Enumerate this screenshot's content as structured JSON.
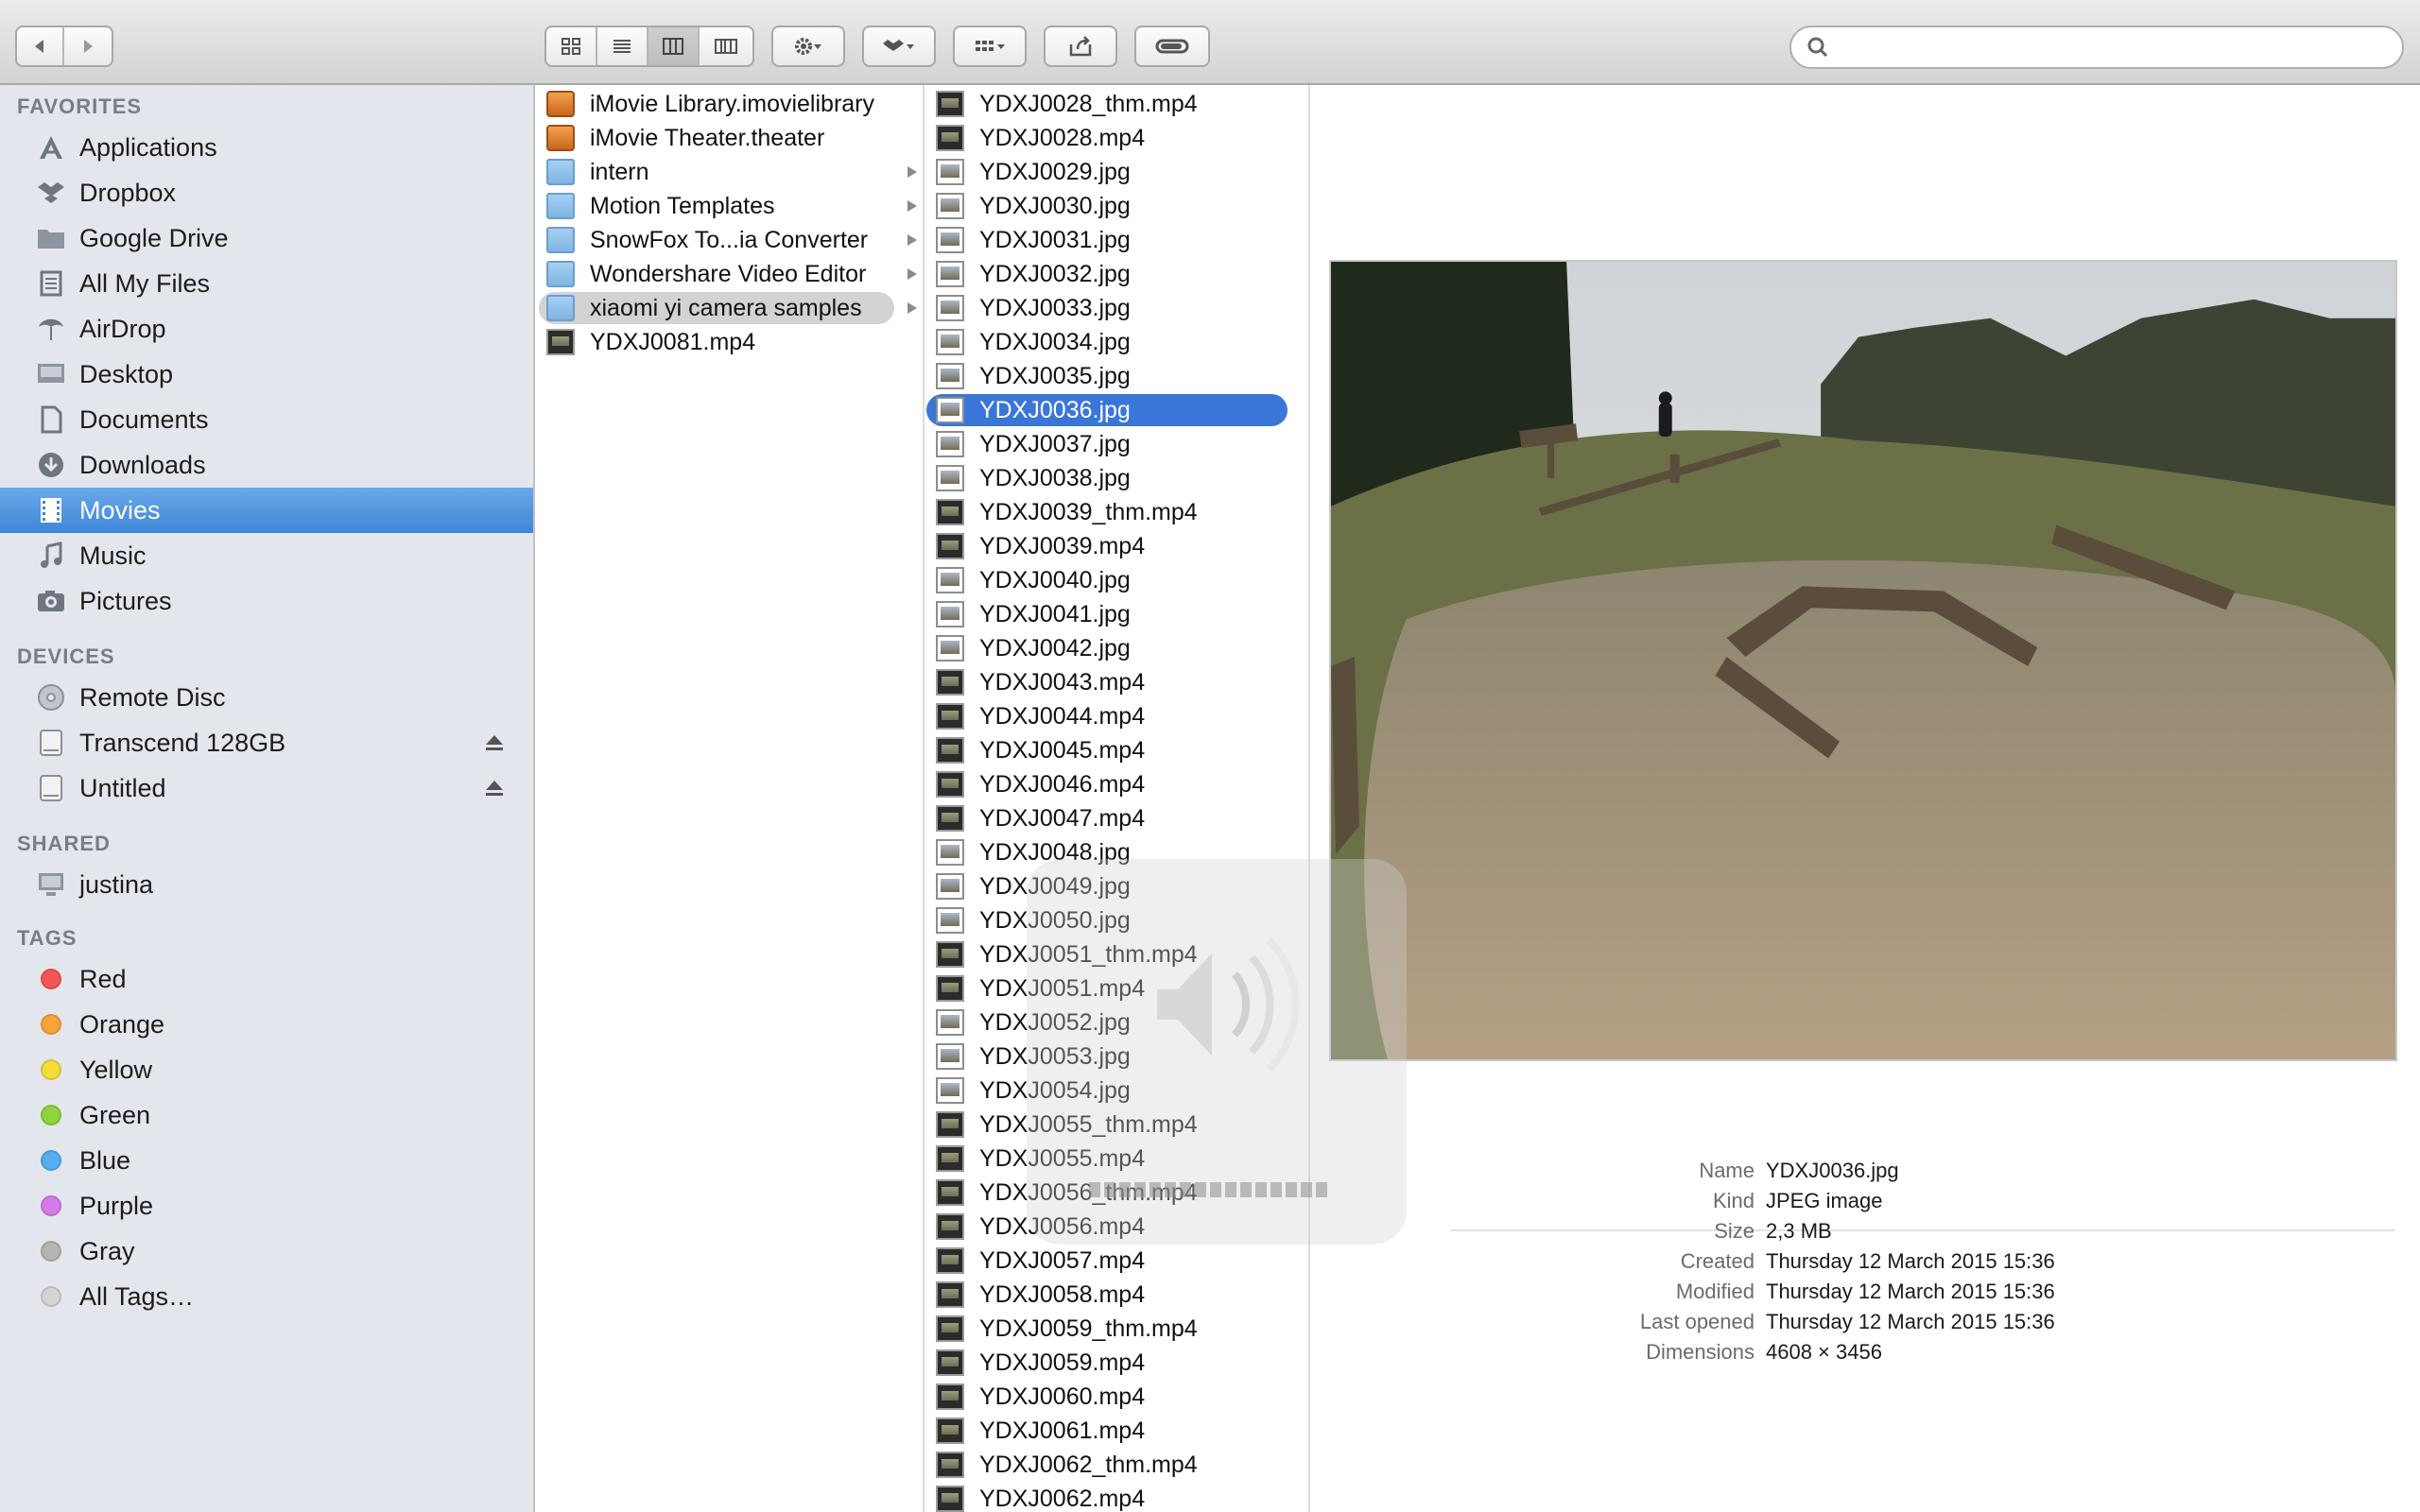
{
  "toolbar": {
    "nav": [
      "back",
      "forward"
    ],
    "view_modes": [
      "icon-view",
      "list-view",
      "column-view",
      "cover-flow-view"
    ],
    "active_view": "column-view",
    "search_placeholder": ""
  },
  "sidebar": {
    "favorites_header": "FAVORITES",
    "favorites": [
      {
        "label": "Applications",
        "icon": "applications-icon"
      },
      {
        "label": "Dropbox",
        "icon": "dropbox-icon"
      },
      {
        "label": "Google Drive",
        "icon": "folder-icon"
      },
      {
        "label": "All My Files",
        "icon": "all-files-icon"
      },
      {
        "label": "AirDrop",
        "icon": "airdrop-icon"
      },
      {
        "label": "Desktop",
        "icon": "desktop-icon"
      },
      {
        "label": "Documents",
        "icon": "documents-icon"
      },
      {
        "label": "Downloads",
        "icon": "downloads-icon"
      },
      {
        "label": "Movies",
        "icon": "movies-icon"
      },
      {
        "label": "Music",
        "icon": "music-icon"
      },
      {
        "label": "Pictures",
        "icon": "pictures-icon"
      }
    ],
    "selected_favorite": "Movies",
    "devices_header": "DEVICES",
    "devices": [
      {
        "label": "Remote Disc",
        "icon": "remote-disc-icon"
      },
      {
        "label": "Transcend 128GB",
        "icon": "disk-icon"
      },
      {
        "label": "Untitled",
        "icon": "disk-icon"
      }
    ],
    "shared_header": "SHARED",
    "shared": [
      {
        "label": "justina",
        "icon": "computer-icon"
      }
    ],
    "tags_header": "TAGS",
    "tags": [
      {
        "label": "Red",
        "color": "#f25757"
      },
      {
        "label": "Orange",
        "color": "#f7a53a"
      },
      {
        "label": "Yellow",
        "color": "#f3dd3b"
      },
      {
        "label": "Green",
        "color": "#8fd43a"
      },
      {
        "label": "Blue",
        "color": "#55aef0"
      },
      {
        "label": "Purple",
        "color": "#d57be8"
      },
      {
        "label": "Gray",
        "color": "#b5b5b5"
      },
      {
        "label": "All Tags…",
        "color": "#d4d4d4"
      }
    ]
  },
  "column1": [
    {
      "name": "iMovie Library.imovielibrary",
      "type": "imovie"
    },
    {
      "name": "iMovie Theater.theater",
      "type": "imovie"
    },
    {
      "name": "intern",
      "type": "folder"
    },
    {
      "name": "Motion Templates",
      "type": "folder"
    },
    {
      "name": "SnowFox To...ia Converter",
      "type": "folder"
    },
    {
      "name": "Wondershare Video Editor",
      "type": "folder"
    },
    {
      "name": "xiaomi yi camera samples",
      "type": "folder",
      "selected": true
    },
    {
      "name": "YDXJ0081.mp4",
      "type": "video"
    }
  ],
  "column2": [
    "YDXJ0028_thm.mp4",
    "YDXJ0028.mp4",
    "YDXJ0029.jpg",
    "YDXJ0030.jpg",
    "YDXJ0031.jpg",
    "YDXJ0032.jpg",
    "YDXJ0033.jpg",
    "YDXJ0034.jpg",
    "YDXJ0035.jpg",
    "YDXJ0036.jpg",
    "YDXJ0037.jpg",
    "YDXJ0038.jpg",
    "YDXJ0039_thm.mp4",
    "YDXJ0039.mp4",
    "YDXJ0040.jpg",
    "YDXJ0041.jpg",
    "YDXJ0042.jpg",
    "YDXJ0043.mp4",
    "YDXJ0044.mp4",
    "YDXJ0045.mp4",
    "YDXJ0046.mp4",
    "YDXJ0047.mp4",
    "YDXJ0048.jpg",
    "YDXJ0049.jpg",
    "YDXJ0050.jpg",
    "YDXJ0051_thm.mp4",
    "YDXJ0051.mp4",
    "YDXJ0052.jpg",
    "YDXJ0053.jpg",
    "YDXJ0054.jpg",
    "YDXJ0055_thm.mp4",
    "YDXJ0055.mp4",
    "YDXJ0056_thm.mp4",
    "YDXJ0056.mp4",
    "YDXJ0057.mp4",
    "YDXJ0058.mp4",
    "YDXJ0059_thm.mp4",
    "YDXJ0059.mp4",
    "YDXJ0060.mp4",
    "YDXJ0061.mp4",
    "YDXJ0062_thm.mp4",
    "YDXJ0062.mp4"
  ],
  "column2_selected": "YDXJ0036.jpg",
  "preview": {
    "info": [
      {
        "key": "Name",
        "value": "YDXJ0036.jpg"
      },
      {
        "key": "Kind",
        "value": "JPEG image"
      },
      {
        "key": "Size",
        "value": "2,3 MB"
      },
      {
        "key": "Created",
        "value": "Thursday 12 March 2015 15:36"
      },
      {
        "key": "Modified",
        "value": "Thursday 12 March 2015 15:36"
      },
      {
        "key": "Last opened",
        "value": "Thursday 12 March 2015 15:36"
      },
      {
        "key": "Dimensions",
        "value": "4608 × 3456"
      }
    ]
  },
  "volume_hud": {
    "icon": "speaker-volume-icon",
    "level": 0
  }
}
